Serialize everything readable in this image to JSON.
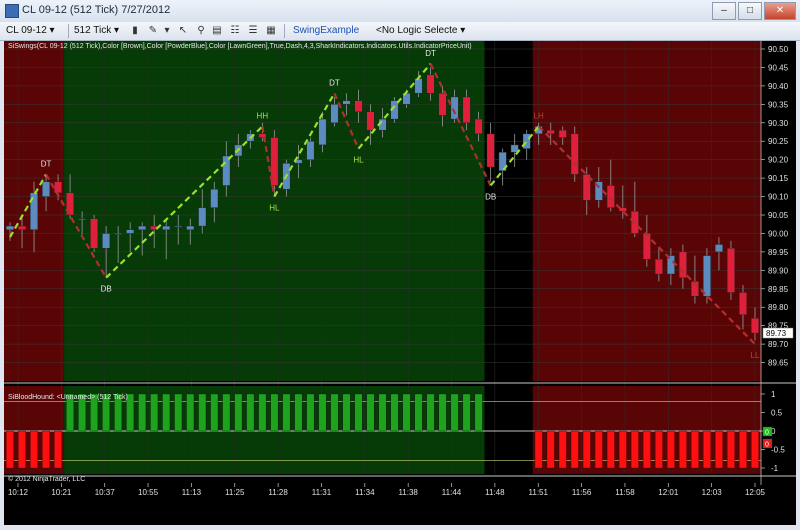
{
  "window": {
    "title": "CL 09-12 (512 Tick)  7/27/2012",
    "buttons": [
      "–",
      "□",
      "✕"
    ]
  },
  "toolbar": {
    "instrument": "CL 09-12",
    "interval": "512 Tick",
    "strategy_link": "SwingExample",
    "logic_select": "<No Logic Selecte"
  },
  "chart": {
    "main_panel_label": "SiSwings(CL 09-12 (512 Tick),Color [Brown],Color [PowderBlue],Color [LawnGreen],True,Dash,4,3,SharkIndicators.Indicators.Utils.IndicatorPriceUnit)",
    "lower_panel_label": "SiBloodHound: <Unnamed> (512 Tick)",
    "copyright": "© 2012 NinjaTrader, LLC",
    "last_price_label": "89.73",
    "lower_axis_ticks": [
      "1",
      "0.5",
      "0",
      "-0.5",
      "-1"
    ],
    "lower_marker_labels": [
      "0",
      "0"
    ],
    "colors": {
      "up_candle": "#5b8bbf",
      "down_candle": "#e0203a",
      "bull_bg": "#063a06",
      "bear_bg": "#5a0505",
      "swing_up": "#9be02a",
      "swing_down": "#b03030"
    }
  },
  "chart_data": {
    "type": "candlestick",
    "ylim": [
      89.6,
      90.5
    ],
    "y_ticks": [
      "90.50",
      "90.45",
      "90.40",
      "90.35",
      "90.30",
      "90.25",
      "90.20",
      "90.15",
      "90.10",
      "90.05",
      "90.00",
      "89.95",
      "89.90",
      "89.85",
      "89.80",
      "89.75",
      "89.70",
      "89.65"
    ],
    "x_ticks": [
      "10:12",
      "10:21",
      "10:37",
      "10:55",
      "11:13",
      "11:25",
      "11:28",
      "11:31",
      "11:34",
      "11:38",
      "11:44",
      "11:48",
      "11:51",
      "11:56",
      "11:58",
      "12:01",
      "12:03",
      "12:05"
    ],
    "candles": [
      {
        "o": 90.01,
        "h": 90.03,
        "l": 89.98,
        "c": 90.02
      },
      {
        "o": 90.02,
        "h": 90.05,
        "l": 89.96,
        "c": 90.01
      },
      {
        "o": 90.01,
        "h": 90.14,
        "l": 89.95,
        "c": 90.11
      },
      {
        "o": 90.1,
        "h": 90.16,
        "l": 90.06,
        "c": 90.14
      },
      {
        "o": 90.14,
        "h": 90.16,
        "l": 90.09,
        "c": 90.11
      },
      {
        "o": 90.11,
        "h": 90.16,
        "l": 90.04,
        "c": 90.05
      },
      {
        "o": 90.04,
        "h": 90.06,
        "l": 89.99,
        "c": 90.04
      },
      {
        "o": 90.04,
        "h": 90.05,
        "l": 89.95,
        "c": 89.96
      },
      {
        "o": 89.96,
        "h": 90.02,
        "l": 89.88,
        "c": 90.0
      },
      {
        "o": 90.0,
        "h": 90.02,
        "l": 89.92,
        "c": 90.0
      },
      {
        "o": 90.0,
        "h": 90.03,
        "l": 89.95,
        "c": 90.01
      },
      {
        "o": 90.01,
        "h": 90.03,
        "l": 89.94,
        "c": 90.02
      },
      {
        "o": 90.02,
        "h": 90.05,
        "l": 89.96,
        "c": 90.01
      },
      {
        "o": 90.01,
        "h": 90.04,
        "l": 89.93,
        "c": 90.02
      },
      {
        "o": 90.02,
        "h": 90.05,
        "l": 89.97,
        "c": 90.02
      },
      {
        "o": 90.01,
        "h": 90.04,
        "l": 89.97,
        "c": 90.02
      },
      {
        "o": 90.02,
        "h": 90.12,
        "l": 90.0,
        "c": 90.07
      },
      {
        "o": 90.07,
        "h": 90.14,
        "l": 90.03,
        "c": 90.12
      },
      {
        "o": 90.13,
        "h": 90.25,
        "l": 90.1,
        "c": 90.21
      },
      {
        "o": 90.21,
        "h": 90.27,
        "l": 90.18,
        "c": 90.24
      },
      {
        "o": 90.25,
        "h": 90.28,
        "l": 90.23,
        "c": 90.27
      },
      {
        "o": 90.27,
        "h": 90.3,
        "l": 90.25,
        "c": 90.26
      },
      {
        "o": 90.26,
        "h": 90.28,
        "l": 90.1,
        "c": 90.13
      },
      {
        "o": 90.12,
        "h": 90.2,
        "l": 90.1,
        "c": 90.19
      },
      {
        "o": 90.19,
        "h": 90.24,
        "l": 90.15,
        "c": 90.2
      },
      {
        "o": 90.2,
        "h": 90.26,
        "l": 90.18,
        "c": 90.25
      },
      {
        "o": 90.24,
        "h": 90.33,
        "l": 90.22,
        "c": 90.31
      },
      {
        "o": 90.3,
        "h": 90.37,
        "l": 90.29,
        "c": 90.35
      },
      {
        "o": 90.35,
        "h": 90.38,
        "l": 90.32,
        "c": 90.36
      },
      {
        "o": 90.36,
        "h": 90.39,
        "l": 90.3,
        "c": 90.33
      },
      {
        "o": 90.33,
        "h": 90.35,
        "l": 90.24,
        "c": 90.28
      },
      {
        "o": 90.28,
        "h": 90.34,
        "l": 90.26,
        "c": 90.31
      },
      {
        "o": 90.31,
        "h": 90.37,
        "l": 90.3,
        "c": 90.36
      },
      {
        "o": 90.35,
        "h": 90.39,
        "l": 90.34,
        "c": 90.38
      },
      {
        "o": 90.38,
        "h": 90.44,
        "l": 90.37,
        "c": 90.42
      },
      {
        "o": 90.43,
        "h": 90.45,
        "l": 90.36,
        "c": 90.38
      },
      {
        "o": 90.38,
        "h": 90.4,
        "l": 90.29,
        "c": 90.32
      },
      {
        "o": 90.31,
        "h": 90.39,
        "l": 90.3,
        "c": 90.37
      },
      {
        "o": 90.37,
        "h": 90.39,
        "l": 90.28,
        "c": 90.3
      },
      {
        "o": 90.31,
        "h": 90.33,
        "l": 90.25,
        "c": 90.27
      },
      {
        "o": 90.27,
        "h": 90.3,
        "l": 90.14,
        "c": 90.18
      },
      {
        "o": 90.17,
        "h": 90.23,
        "l": 90.13,
        "c": 90.22
      },
      {
        "o": 90.22,
        "h": 90.27,
        "l": 90.18,
        "c": 90.24
      },
      {
        "o": 90.23,
        "h": 90.28,
        "l": 90.2,
        "c": 90.27
      },
      {
        "o": 90.27,
        "h": 90.3,
        "l": 90.24,
        "c": 90.29
      },
      {
        "o": 90.28,
        "h": 90.3,
        "l": 90.24,
        "c": 90.27
      },
      {
        "o": 90.28,
        "h": 90.29,
        "l": 90.24,
        "c": 90.26
      },
      {
        "o": 90.27,
        "h": 90.29,
        "l": 90.14,
        "c": 90.16
      },
      {
        "o": 90.16,
        "h": 90.18,
        "l": 90.05,
        "c": 90.09
      },
      {
        "o": 90.09,
        "h": 90.18,
        "l": 90.07,
        "c": 90.14
      },
      {
        "o": 90.13,
        "h": 90.2,
        "l": 90.06,
        "c": 90.07
      },
      {
        "o": 90.07,
        "h": 90.13,
        "l": 90.04,
        "c": 90.06
      },
      {
        "o": 90.06,
        "h": 90.14,
        "l": 89.99,
        "c": 90.0
      },
      {
        "o": 90.0,
        "h": 90.05,
        "l": 89.91,
        "c": 89.93
      },
      {
        "o": 89.93,
        "h": 89.96,
        "l": 89.87,
        "c": 89.89
      },
      {
        "o": 89.89,
        "h": 89.96,
        "l": 89.86,
        "c": 89.94
      },
      {
        "o": 89.95,
        "h": 89.97,
        "l": 89.85,
        "c": 89.88
      },
      {
        "o": 89.87,
        "h": 89.94,
        "l": 89.81,
        "c": 89.83
      },
      {
        "o": 89.83,
        "h": 89.96,
        "l": 89.81,
        "c": 89.94
      },
      {
        "o": 89.95,
        "h": 89.99,
        "l": 89.9,
        "c": 89.97
      },
      {
        "o": 89.96,
        "h": 89.98,
        "l": 89.82,
        "c": 89.84
      },
      {
        "o": 89.84,
        "h": 89.86,
        "l": 89.74,
        "c": 89.78
      },
      {
        "o": 89.77,
        "h": 89.8,
        "l": 89.71,
        "c": 89.73
      }
    ],
    "swings": [
      {
        "from": [
          0,
          89.99
        ],
        "to": [
          3,
          90.16
        ],
        "dir": "up"
      },
      {
        "from": [
          3,
          90.16
        ],
        "to": [
          8,
          89.88
        ],
        "dir": "down"
      },
      {
        "from": [
          8,
          89.88
        ],
        "to": [
          21,
          90.29
        ],
        "dir": "up"
      },
      {
        "from": [
          21,
          90.29
        ],
        "to": [
          22,
          90.1
        ],
        "dir": "down"
      },
      {
        "from": [
          22,
          90.1
        ],
        "to": [
          27,
          90.38
        ],
        "dir": "up"
      },
      {
        "from": [
          27,
          90.38
        ],
        "to": [
          29,
          90.23
        ],
        "dir": "down"
      },
      {
        "from": [
          29,
          90.23
        ],
        "to": [
          35,
          90.46
        ],
        "dir": "up"
      },
      {
        "from": [
          35,
          90.46
        ],
        "to": [
          40,
          90.13
        ],
        "dir": "down"
      },
      {
        "from": [
          40,
          90.13
        ],
        "to": [
          44,
          90.29
        ],
        "dir": "up"
      },
      {
        "from": [
          44,
          90.29
        ],
        "to": [
          62,
          89.7
        ],
        "dir": "down"
      }
    ],
    "swing_labels": [
      {
        "i": 3,
        "y": 90.16,
        "text": "DT",
        "pos": "above"
      },
      {
        "i": 8,
        "y": 89.88,
        "text": "DB",
        "pos": "below"
      },
      {
        "i": 21,
        "y": 90.29,
        "text": "HH",
        "pos": "above"
      },
      {
        "i": 22,
        "y": 90.1,
        "text": "HL",
        "pos": "below"
      },
      {
        "i": 27,
        "y": 90.38,
        "text": "DT",
        "pos": "above"
      },
      {
        "i": 29,
        "y": 90.23,
        "text": "HL",
        "pos": "below"
      },
      {
        "i": 35,
        "y": 90.46,
        "text": "DT",
        "pos": "above"
      },
      {
        "i": 40,
        "y": 90.13,
        "text": "DB",
        "pos": "below"
      },
      {
        "i": 44,
        "y": 90.29,
        "text": "LH",
        "pos": "above"
      },
      {
        "i": 62,
        "y": 89.7,
        "text": "LL",
        "pos": "below"
      }
    ],
    "regions": [
      {
        "from": 0,
        "to": 4,
        "trend": "bear"
      },
      {
        "from": 5,
        "to": 39,
        "trend": "bull"
      },
      {
        "from": 40,
        "to": 43,
        "trend": "neutral"
      },
      {
        "from": 44,
        "to": 62,
        "trend": "bear"
      }
    ],
    "indicator_values": [
      -1,
      -1,
      -1,
      -1,
      -1,
      1,
      1,
      1,
      1,
      1,
      1,
      1,
      1,
      1,
      1,
      1,
      1,
      1,
      1,
      1,
      1,
      1,
      1,
      1,
      1,
      1,
      1,
      1,
      1,
      1,
      1,
      1,
      1,
      1,
      1,
      1,
      1,
      1,
      1,
      1,
      0,
      0,
      0,
      0,
      -1,
      -1,
      -1,
      -1,
      -1,
      -1,
      -1,
      -1,
      -1,
      -1,
      -1,
      -1,
      -1,
      -1,
      -1,
      -1,
      -1,
      -1,
      -1
    ]
  }
}
